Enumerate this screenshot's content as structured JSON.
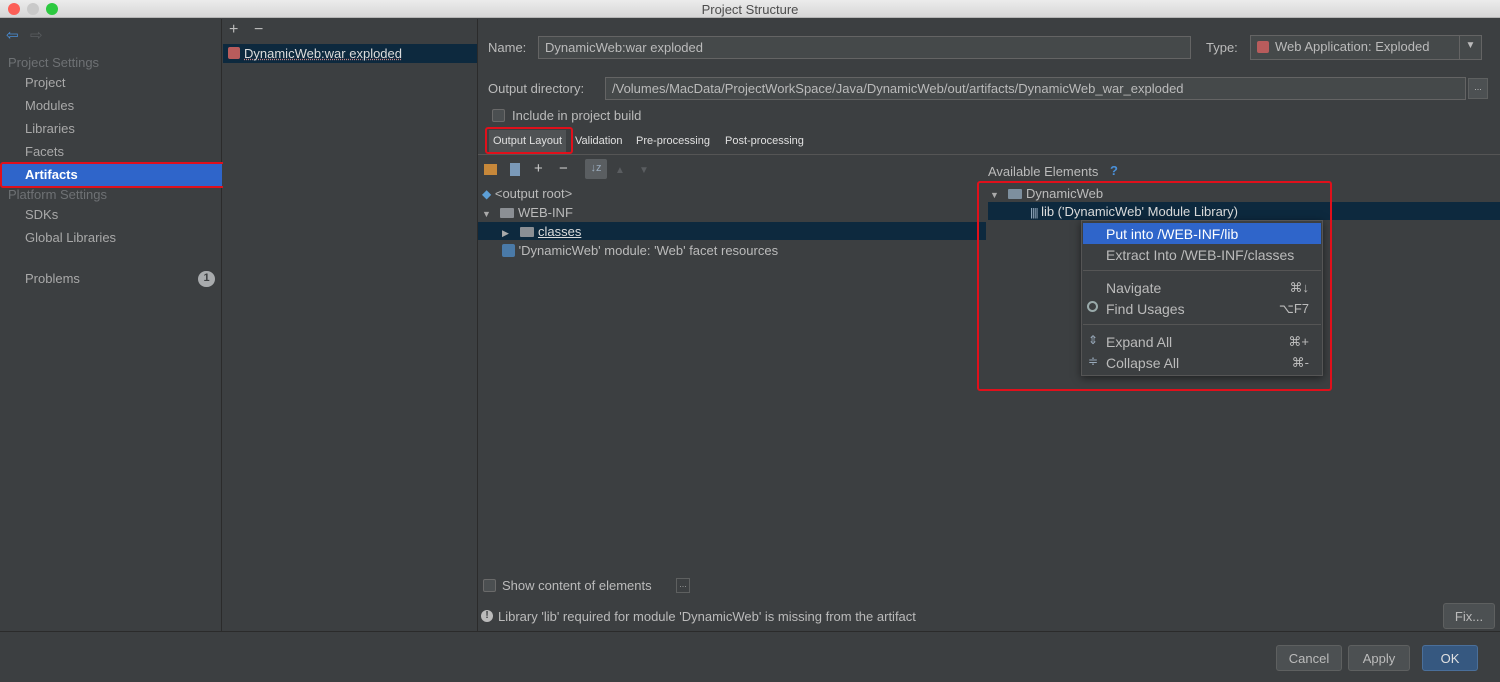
{
  "window": {
    "title": "Project Structure"
  },
  "sidebar": {
    "project_settings_header": "Project Settings",
    "project_items": [
      "Project",
      "Modules",
      "Libraries",
      "Facets"
    ],
    "selected": "Artifacts",
    "platform_settings_header": "Platform Settings",
    "platform_items": [
      "SDKs",
      "Global Libraries"
    ],
    "problems_label": "Problems",
    "problems_count": "1"
  },
  "artifacts_list": {
    "add": "+",
    "remove": "−",
    "items": [
      "DynamicWeb:war exploded"
    ]
  },
  "form": {
    "name_label": "Name:",
    "name_value": "DynamicWeb:war exploded",
    "type_label": "Type:",
    "type_value": "Web Application: Exploded",
    "output_dir_label": "Output directory:",
    "output_dir_value": "/Volumes/MacData/ProjectWorkSpace/Java/DynamicWeb/out/artifacts/DynamicWeb_war_exploded",
    "browse_label": "...",
    "include_build_label": "Include in project build"
  },
  "tabs": [
    "Output Layout",
    "Validation",
    "Pre-processing",
    "Post-processing"
  ],
  "output_tree": {
    "root": "<output root>",
    "web_inf": "WEB-INF",
    "classes": "classes",
    "facet_resources": "'DynamicWeb' module: 'Web' facet resources"
  },
  "available": {
    "header": "Available Elements",
    "help": "?",
    "module": "DynamicWeb",
    "lib": "lib ('DynamicWeb' Module Library)"
  },
  "context_menu": {
    "items": [
      {
        "label": "Put into /WEB-INF/lib",
        "shortcut": ""
      },
      {
        "label": "Extract Into /WEB-INF/classes",
        "shortcut": ""
      },
      {
        "label": "Navigate",
        "shortcut": "⌘↓"
      },
      {
        "label": "Find Usages",
        "shortcut": "⌥F7"
      },
      {
        "label": "Expand All",
        "shortcut": "⌘+"
      },
      {
        "label": "Collapse All",
        "shortcut": "⌘-"
      }
    ]
  },
  "bottom": {
    "show_content_label": "Show content of elements",
    "show_content_more": "...",
    "warning": "Library 'lib' required for module 'DynamicWeb' is missing from the artifact",
    "fix_label": "Fix..."
  },
  "buttons": {
    "cancel": "Cancel",
    "apply": "Apply",
    "ok": "OK"
  },
  "colors": {
    "selection": "#2f65ca",
    "highlight_box": "#e0101b",
    "tree_selection": "#0d293e"
  }
}
